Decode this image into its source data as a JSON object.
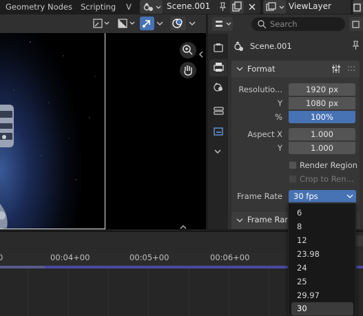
{
  "topbar": {
    "tabs": [
      "Geometry Nodes",
      "Scripting",
      "V"
    ],
    "scene_name": "Scene.001",
    "view_layer": "ViewLayer"
  },
  "properties": {
    "search_placeholder": "Search",
    "scene_name": "Scene.001",
    "format_panel": {
      "title": "Format",
      "resolution_x_label": "Resolutio...",
      "resolution_x": "1920 px",
      "resolution_y_label": "Y",
      "resolution_y": "1080 px",
      "percent_label": "%",
      "percent": "100%",
      "aspect_x_label": "Aspect X",
      "aspect_x": "1.000",
      "aspect_y_label": "Y",
      "aspect_y": "1.000",
      "render_region": "Render Region",
      "crop_to_render": "Crop to Ren...",
      "frame_rate_label": "Frame Rate",
      "frame_rate": "30 fps"
    },
    "frame_range_panel": {
      "title": "Frame Rang"
    }
  },
  "dropdown": {
    "options": [
      "6",
      "8",
      "12",
      "23.98",
      "24",
      "25",
      "29.97",
      "30"
    ],
    "selected": "30"
  },
  "timeline": {
    "ticks": [
      "0",
      "00:04+00",
      "00:05+00",
      "00:06+00"
    ]
  },
  "colors": {
    "accent": "#4772b3",
    "panel": "#303030",
    "field": "#545454"
  }
}
